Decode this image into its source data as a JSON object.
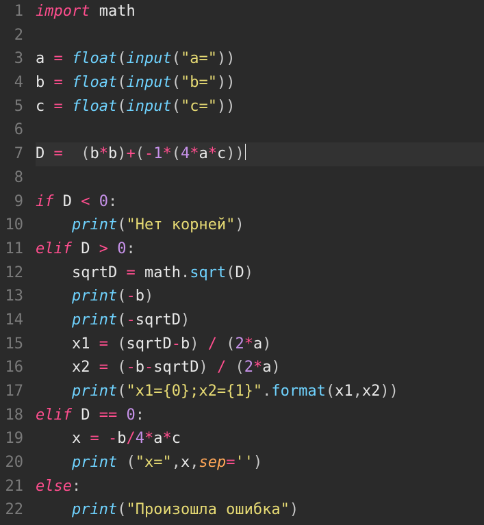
{
  "editor": {
    "highlighted_line": 7,
    "lines": [
      {
        "n": 1,
        "tokens": [
          [
            "keyword",
            "import"
          ],
          [
            "sp",
            " "
          ],
          [
            "var",
            "math"
          ]
        ]
      },
      {
        "n": 2,
        "tokens": []
      },
      {
        "n": 3,
        "tokens": [
          [
            "var",
            "a"
          ],
          [
            "sp",
            " "
          ],
          [
            "op",
            "="
          ],
          [
            "sp",
            " "
          ],
          [
            "builtin",
            "float"
          ],
          [
            "punct",
            "("
          ],
          [
            "builtin",
            "input"
          ],
          [
            "punct",
            "("
          ],
          [
            "str",
            "\"a=\""
          ],
          [
            "punct",
            ")"
          ],
          [
            "punct",
            ")"
          ]
        ]
      },
      {
        "n": 4,
        "tokens": [
          [
            "var",
            "b"
          ],
          [
            "sp",
            " "
          ],
          [
            "op",
            "="
          ],
          [
            "sp",
            " "
          ],
          [
            "builtin",
            "float"
          ],
          [
            "punct",
            "("
          ],
          [
            "builtin",
            "input"
          ],
          [
            "punct",
            "("
          ],
          [
            "str",
            "\"b=\""
          ],
          [
            "punct",
            ")"
          ],
          [
            "punct",
            ")"
          ]
        ]
      },
      {
        "n": 5,
        "tokens": [
          [
            "var",
            "c"
          ],
          [
            "sp",
            " "
          ],
          [
            "op",
            "="
          ],
          [
            "sp",
            " "
          ],
          [
            "builtin",
            "float"
          ],
          [
            "punct",
            "("
          ],
          [
            "builtin",
            "input"
          ],
          [
            "punct",
            "("
          ],
          [
            "str",
            "\"c=\""
          ],
          [
            "punct",
            ")"
          ],
          [
            "punct",
            ")"
          ]
        ]
      },
      {
        "n": 6,
        "tokens": []
      },
      {
        "n": 7,
        "tokens": [
          [
            "var",
            "D"
          ],
          [
            "sp",
            " "
          ],
          [
            "op",
            "="
          ],
          [
            "sp",
            "  "
          ],
          [
            "punct",
            "("
          ],
          [
            "var",
            "b"
          ],
          [
            "op",
            "*"
          ],
          [
            "var",
            "b"
          ],
          [
            "punct",
            ")"
          ],
          [
            "op",
            "+"
          ],
          [
            "punct",
            "("
          ],
          [
            "op",
            "-"
          ],
          [
            "num",
            "1"
          ],
          [
            "op",
            "*"
          ],
          [
            "punct",
            "("
          ],
          [
            "num",
            "4"
          ],
          [
            "op",
            "*"
          ],
          [
            "var",
            "a"
          ],
          [
            "op",
            "*"
          ],
          [
            "var",
            "c"
          ],
          [
            "punct",
            ")"
          ],
          [
            "punct",
            ")"
          ],
          [
            "cursor",
            ""
          ]
        ]
      },
      {
        "n": 8,
        "tokens": []
      },
      {
        "n": 9,
        "tokens": [
          [
            "keyword",
            "if"
          ],
          [
            "sp",
            " "
          ],
          [
            "var",
            "D"
          ],
          [
            "sp",
            " "
          ],
          [
            "op",
            "<"
          ],
          [
            "sp",
            " "
          ],
          [
            "num",
            "0"
          ],
          [
            "punct",
            ":"
          ]
        ]
      },
      {
        "n": 10,
        "tokens": [
          [
            "sp",
            "    "
          ],
          [
            "builtin",
            "print"
          ],
          [
            "punct",
            "("
          ],
          [
            "str",
            "\"Нет корней\""
          ],
          [
            "punct",
            ")"
          ]
        ]
      },
      {
        "n": 11,
        "tokens": [
          [
            "keyword",
            "elif"
          ],
          [
            "sp",
            " "
          ],
          [
            "var",
            "D"
          ],
          [
            "sp",
            " "
          ],
          [
            "op",
            ">"
          ],
          [
            "sp",
            " "
          ],
          [
            "num",
            "0"
          ],
          [
            "punct",
            ":"
          ]
        ]
      },
      {
        "n": 12,
        "tokens": [
          [
            "sp",
            "    "
          ],
          [
            "var",
            "sqrtD"
          ],
          [
            "sp",
            " "
          ],
          [
            "op",
            "="
          ],
          [
            "sp",
            " "
          ],
          [
            "var",
            "math"
          ],
          [
            "punct",
            "."
          ],
          [
            "func",
            "sqrt"
          ],
          [
            "punct",
            "("
          ],
          [
            "var",
            "D"
          ],
          [
            "punct",
            ")"
          ]
        ]
      },
      {
        "n": 13,
        "tokens": [
          [
            "sp",
            "    "
          ],
          [
            "builtin",
            "print"
          ],
          [
            "punct",
            "("
          ],
          [
            "op",
            "-"
          ],
          [
            "var",
            "b"
          ],
          [
            "punct",
            ")"
          ]
        ]
      },
      {
        "n": 14,
        "tokens": [
          [
            "sp",
            "    "
          ],
          [
            "builtin",
            "print"
          ],
          [
            "punct",
            "("
          ],
          [
            "op",
            "-"
          ],
          [
            "var",
            "sqrtD"
          ],
          [
            "punct",
            ")"
          ]
        ]
      },
      {
        "n": 15,
        "tokens": [
          [
            "sp",
            "    "
          ],
          [
            "var",
            "x1"
          ],
          [
            "sp",
            " "
          ],
          [
            "op",
            "="
          ],
          [
            "sp",
            " "
          ],
          [
            "punct",
            "("
          ],
          [
            "var",
            "sqrtD"
          ],
          [
            "op",
            "-"
          ],
          [
            "var",
            "b"
          ],
          [
            "punct",
            ")"
          ],
          [
            "sp",
            " "
          ],
          [
            "op",
            "/"
          ],
          [
            "sp",
            " "
          ],
          [
            "punct",
            "("
          ],
          [
            "num",
            "2"
          ],
          [
            "op",
            "*"
          ],
          [
            "var",
            "a"
          ],
          [
            "punct",
            ")"
          ]
        ]
      },
      {
        "n": 16,
        "tokens": [
          [
            "sp",
            "    "
          ],
          [
            "var",
            "x2"
          ],
          [
            "sp",
            " "
          ],
          [
            "op",
            "="
          ],
          [
            "sp",
            " "
          ],
          [
            "punct",
            "("
          ],
          [
            "op",
            "-"
          ],
          [
            "var",
            "b"
          ],
          [
            "op",
            "-"
          ],
          [
            "var",
            "sqrtD"
          ],
          [
            "punct",
            ")"
          ],
          [
            "sp",
            " "
          ],
          [
            "op",
            "/"
          ],
          [
            "sp",
            " "
          ],
          [
            "punct",
            "("
          ],
          [
            "num",
            "2"
          ],
          [
            "op",
            "*"
          ],
          [
            "var",
            "a"
          ],
          [
            "punct",
            ")"
          ]
        ]
      },
      {
        "n": 17,
        "tokens": [
          [
            "sp",
            "    "
          ],
          [
            "builtin",
            "print"
          ],
          [
            "punct",
            "("
          ],
          [
            "str",
            "\"x1={0};x2={1}\""
          ],
          [
            "punct",
            "."
          ],
          [
            "func",
            "format"
          ],
          [
            "punct",
            "("
          ],
          [
            "var",
            "x1"
          ],
          [
            "punct",
            ","
          ],
          [
            "var",
            "x2"
          ],
          [
            "punct",
            ")"
          ],
          [
            "punct",
            ")"
          ]
        ]
      },
      {
        "n": 18,
        "tokens": [
          [
            "keyword",
            "elif"
          ],
          [
            "sp",
            " "
          ],
          [
            "var",
            "D"
          ],
          [
            "sp",
            " "
          ],
          [
            "op",
            "=="
          ],
          [
            "sp",
            " "
          ],
          [
            "num",
            "0"
          ],
          [
            "punct",
            ":"
          ]
        ]
      },
      {
        "n": 19,
        "tokens": [
          [
            "sp",
            "    "
          ],
          [
            "var",
            "x"
          ],
          [
            "sp",
            " "
          ],
          [
            "op",
            "="
          ],
          [
            "sp",
            " "
          ],
          [
            "op",
            "-"
          ],
          [
            "var",
            "b"
          ],
          [
            "op",
            "/"
          ],
          [
            "num",
            "4"
          ],
          [
            "op",
            "*"
          ],
          [
            "var",
            "a"
          ],
          [
            "op",
            "*"
          ],
          [
            "var",
            "c"
          ]
        ]
      },
      {
        "n": 20,
        "tokens": [
          [
            "sp",
            "    "
          ],
          [
            "builtin",
            "print"
          ],
          [
            "sp",
            " "
          ],
          [
            "punct",
            "("
          ],
          [
            "str",
            "\"x=\""
          ],
          [
            "punct",
            ","
          ],
          [
            "var",
            "x"
          ],
          [
            "punct",
            ","
          ],
          [
            "kwarg",
            "sep"
          ],
          [
            "op",
            "="
          ],
          [
            "str",
            "''"
          ],
          [
            "punct",
            ")"
          ]
        ]
      },
      {
        "n": 21,
        "tokens": [
          [
            "keyword",
            "else"
          ],
          [
            "punct",
            ":"
          ]
        ]
      },
      {
        "n": 22,
        "tokens": [
          [
            "sp",
            "    "
          ],
          [
            "builtin",
            "print"
          ],
          [
            "punct",
            "("
          ],
          [
            "str",
            "\"Произошла ошибка\""
          ],
          [
            "punct",
            ")"
          ]
        ]
      }
    ]
  }
}
